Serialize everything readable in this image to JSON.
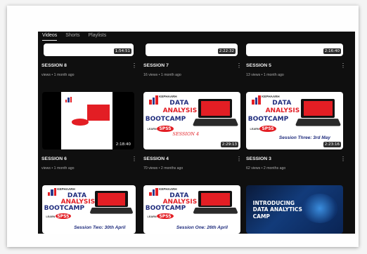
{
  "tabs": [
    "Videos",
    "Shorts",
    "Playlists"
  ],
  "row0": [
    {
      "duration": "1:54:51"
    },
    {
      "duration": "2:22:32"
    },
    {
      "duration": "2:16:40"
    }
  ],
  "row1": [
    {
      "title": "SESSION 8",
      "meta": "views • 1 month ago"
    },
    {
      "title": "SESSION 7",
      "meta": "16 views • 1 month ago"
    },
    {
      "title": "SESSION 5",
      "meta": "13 views • 1 month ago"
    }
  ],
  "row2": [
    {
      "duration": "2:18:40",
      "title": "SESSION 6",
      "meta": "views • 1 month ago"
    },
    {
      "duration": "2:29:13",
      "title": "SESSION 4",
      "meta": "70 views • 2 months ago",
      "session_text": "SESSION 4"
    },
    {
      "duration": "2:23:16",
      "title": "SESSION 3",
      "meta": "62 views • 2 months ago",
      "session_text": "Session Three: 3rd May"
    }
  ],
  "row3": [
    {
      "session_text": "Session Two: 30th April"
    },
    {
      "session_text": "Session One: 26th April"
    },
    {
      "line1": "INTRODUCING",
      "line2": "DATA ANALYTICS",
      "line3": "CAMP"
    }
  ],
  "promo": {
    "brand": "KEPHAARH",
    "line1": "DATA",
    "line2": "ANALYSIS",
    "line3": "BOOTCAMP",
    "learn": "LEARN",
    "spss": "SPSS"
  },
  "colors": {
    "background": "#0f0f0f",
    "primary_text": "#f1f1f1",
    "secondary_text": "#aaaaaa",
    "brand_red": "#e31e24",
    "brand_blue": "#1f2c7d"
  }
}
